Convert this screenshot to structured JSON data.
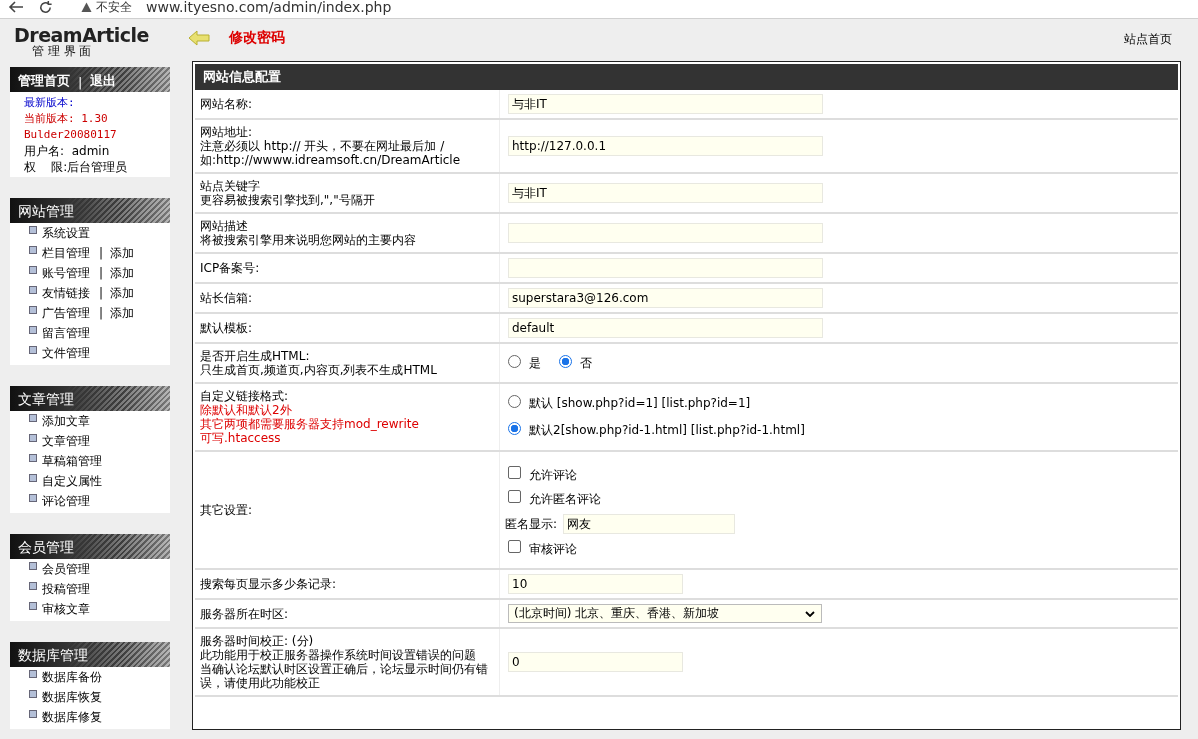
{
  "browser": {
    "security": "不安全",
    "url": "www.ityesno.com/admin/index.php"
  },
  "header": {
    "logo": "DreamArticle",
    "subtitle": "管 理 界 面",
    "change_password": "修改密码",
    "site_home": "站点首页"
  },
  "sidebar": {
    "top": {
      "links": [
        "管理首页",
        "退出"
      ],
      "separator": "|"
    },
    "info": [
      {
        "text": "最新版本:",
        "kind": "latest"
      },
      {
        "text": "当前版本: 1.30",
        "kind": "current"
      },
      {
        "text": "Bulder20080117",
        "kind": "current"
      },
      {
        "text": "用户名:  admin",
        "kind": "user"
      },
      {
        "text": "权    限:后台管理员",
        "kind": "user"
      }
    ],
    "sections": [
      {
        "title": "网站管理",
        "items": [
          {
            "label": "系统设置"
          },
          {
            "label": "栏目管理",
            "separator": "|",
            "action": "添加"
          },
          {
            "label": "账号管理",
            "separator": "|",
            "action": "添加"
          },
          {
            "label": "友情链接",
            "separator": "|",
            "action": "添加"
          },
          {
            "label": "广告管理",
            "separator": "|",
            "action": "添加"
          },
          {
            "label": "留言管理"
          },
          {
            "label": "文件管理"
          }
        ]
      },
      {
        "title": "文章管理",
        "items": [
          {
            "label": "添加文章"
          },
          {
            "label": "文章管理"
          },
          {
            "label": "草稿箱管理"
          },
          {
            "label": "自定义属性"
          },
          {
            "label": "评论管理"
          }
        ]
      },
      {
        "title": "会员管理",
        "items": [
          {
            "label": "会员管理"
          },
          {
            "label": "投稿管理"
          },
          {
            "label": "审核文章"
          }
        ]
      },
      {
        "title": "数据库管理",
        "items": [
          {
            "label": "数据库备份"
          },
          {
            "label": "数据库恢复"
          },
          {
            "label": "数据库修复"
          }
        ]
      }
    ]
  },
  "panel": {
    "title": "网站信息配置",
    "rows": [
      {
        "kind": "text",
        "label": "网站名称:",
        "value": "与非IT"
      },
      {
        "kind": "text",
        "label": "网站地址:",
        "hints": [
          "注意必须以 http:// 开头，不要在网址最后加 /",
          "如:http://wwww.idreamsoft.cn/DreamArticle"
        ],
        "value": "http://127.0.0.1"
      },
      {
        "kind": "text",
        "label": "站点关键字",
        "hints": [
          "更容易被搜索引擎找到,\",\"号隔开"
        ],
        "value": "与非IT"
      },
      {
        "kind": "text",
        "label": "网站描述",
        "hints": [
          "将被搜索引擎用来说明您网站的主要内容"
        ]
      },
      {
        "kind": "text",
        "label": "ICP备案号:"
      },
      {
        "kind": "text",
        "label": "站长信箱:",
        "value": "superstara3@126.com"
      },
      {
        "kind": "text",
        "label": "默认模板:",
        "value": "default"
      },
      {
        "kind": "radio",
        "label": "是否开启生成HTML:",
        "hints": [
          "只生成首页,频道页,内容页,列表不生成HTML"
        ],
        "options": [
          {
            "label": "是",
            "selected": false
          },
          {
            "label": "否",
            "selected": true
          }
        ]
      },
      {
        "kind": "radio-list",
        "label": "自定义链接格式:",
        "warnings": [
          "除默认和默认2外",
          "其它两项都需要服务器支持mod_rewrite",
          "可写.htaccess"
        ],
        "options": [
          {
            "label": "默认 [show.php?id=1] [list.php?id=1]",
            "selected": false
          },
          {
            "label": "默认2[show.php?id-1.html] [list.php?id-1.html]",
            "selected": true
          }
        ]
      },
      {
        "kind": "options",
        "label": "其它设置:",
        "items": [
          {
            "kind": "checkbox",
            "label": "允许评论",
            "checked": false
          },
          {
            "kind": "checkbox",
            "label": "允许匿名评论",
            "checked": false
          },
          {
            "kind": "field",
            "label": "匿名显示:",
            "value": "网友"
          },
          {
            "kind": "checkbox",
            "label": "审核评论",
            "checked": false
          }
        ]
      },
      {
        "kind": "number",
        "label": "搜索每页显示多少条记录:",
        "value": "10"
      },
      {
        "kind": "select",
        "label": "服务器所在时区:",
        "value": "(北京时间) 北京、重庆、香港、新加坡"
      },
      {
        "kind": "number",
        "label": "服务器时间校正: (分)",
        "hints": [
          "此功能用于校正服务器操作系统时间设置错误的问题",
          "当确认论坛默认时区设置正确后，论坛显示时间仍有错误，请使用此功能校正"
        ],
        "value": "0"
      }
    ]
  }
}
